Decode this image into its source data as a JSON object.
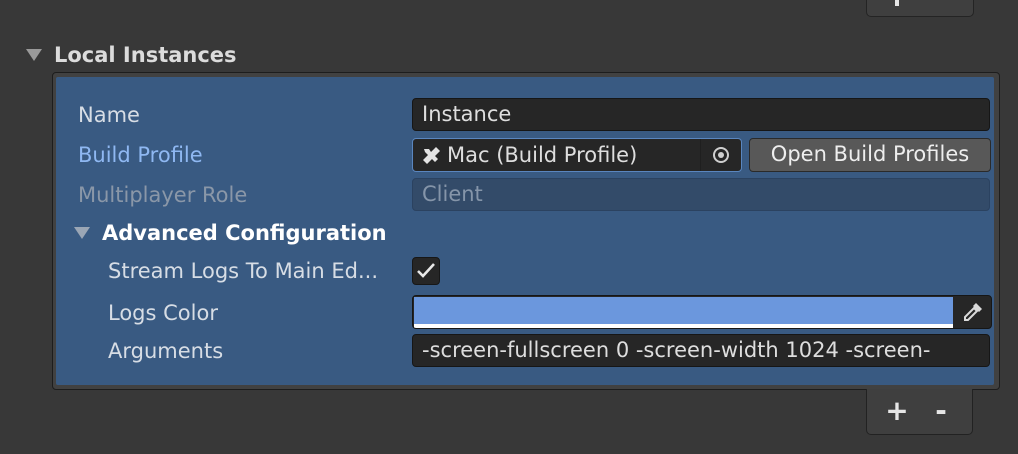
{
  "section": {
    "title": "Local Instances"
  },
  "instance": {
    "name_label": "Name",
    "name_value": "Instance",
    "build_profile_label": "Build Profile",
    "build_profile_value": "Mac (Build Profile)",
    "open_build_profiles_label": "Open Build Profiles",
    "multiplayer_role_label": "Multiplayer Role",
    "multiplayer_role_value": "Client",
    "advanced": {
      "title": "Advanced Configuration",
      "stream_logs_label": "Stream Logs To Main Ed...",
      "stream_logs_checked": true,
      "logs_color_label": "Logs Color",
      "logs_color_value": "#6b97dd",
      "arguments_label": "Arguments",
      "arguments_value": "-screen-fullscreen 0 -screen-width 1024 -screen-"
    }
  },
  "footer": {
    "add_label": "+",
    "remove_label": "-"
  },
  "icons": {
    "foldout": "triangle-down-icon",
    "build_profile": "tools-icon",
    "object_picker": "object-picker-icon",
    "checkbox": "checkmark-icon",
    "color_picker": "eyedropper-icon"
  },
  "colors": {
    "selection": "#395a82",
    "link_label": "#8fb8f2"
  }
}
